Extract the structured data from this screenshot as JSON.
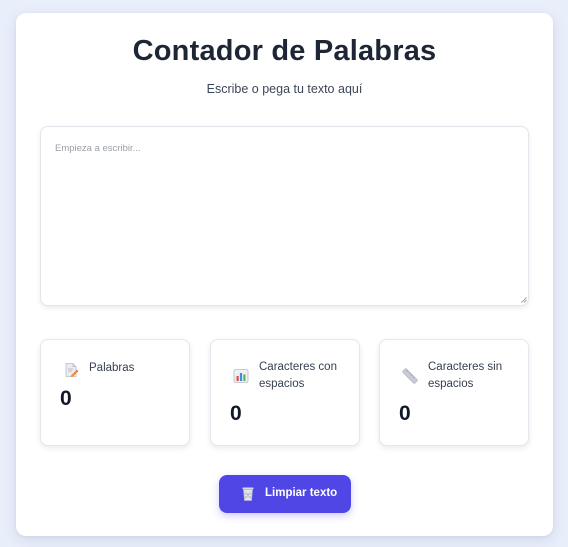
{
  "header": {
    "title": "Contador de Palabras",
    "subtitle": "Escribe o pega tu texto aquí"
  },
  "editor": {
    "placeholder": "Empieza a escribir...",
    "value": ""
  },
  "stats": [
    {
      "icon": "memo-icon",
      "label": "Palabras",
      "value": "0"
    },
    {
      "icon": "bar-chart-icon",
      "label": "Caracteres con espacios",
      "value": "0"
    },
    {
      "icon": "ruler-icon",
      "label": "Caracteres sin espacios",
      "value": "0"
    }
  ],
  "actions": {
    "clear_icon": "wastebasket-icon",
    "clear_label": "Limpiar texto"
  },
  "colors": {
    "background": "#e9eefb",
    "card": "#ffffff",
    "accent": "#4f46e5",
    "title": "#1e2636"
  }
}
